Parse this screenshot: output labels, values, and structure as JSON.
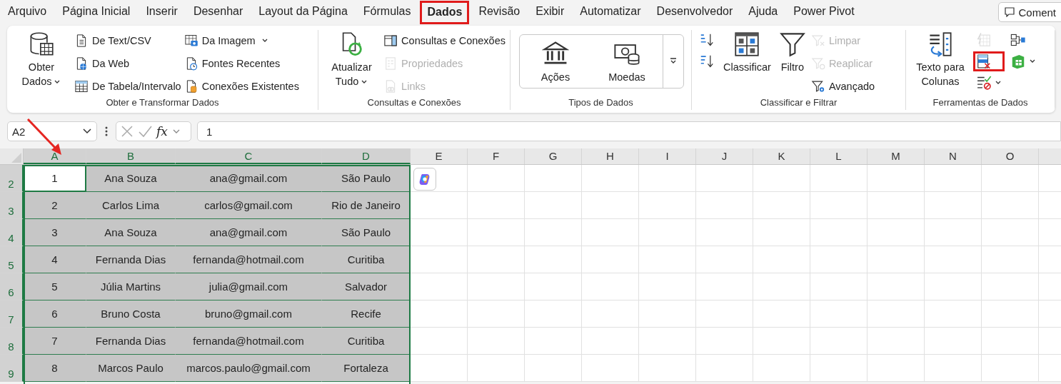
{
  "menu_tabs": [
    {
      "label": "Arquivo",
      "selected": false,
      "highlighted": false
    },
    {
      "label": "Página Inicial",
      "selected": false,
      "highlighted": false
    },
    {
      "label": "Inserir",
      "selected": false,
      "highlighted": false
    },
    {
      "label": "Desenhar",
      "selected": false,
      "highlighted": false
    },
    {
      "label": "Layout da Página",
      "selected": false,
      "highlighted": false
    },
    {
      "label": "Fórmulas",
      "selected": false,
      "highlighted": false
    },
    {
      "label": "Dados",
      "selected": true,
      "highlighted": true
    },
    {
      "label": "Revisão",
      "selected": false,
      "highlighted": false
    },
    {
      "label": "Exibir",
      "selected": false,
      "highlighted": false
    },
    {
      "label": "Automatizar",
      "selected": false,
      "highlighted": false
    },
    {
      "label": "Desenvolvedor",
      "selected": false,
      "highlighted": false
    },
    {
      "label": "Ajuda",
      "selected": false,
      "highlighted": false
    },
    {
      "label": "Power Pivot",
      "selected": false,
      "highlighted": false
    }
  ],
  "comments_button": {
    "label": "Coment"
  },
  "ribbon": {
    "groups": [
      {
        "label": "Obter e Transformar Dados",
        "buttons": [
          {
            "kind": "large",
            "label": "Obter Dados",
            "dropdown": true,
            "disabled": false,
            "highlighted": false
          },
          {
            "kind": "small",
            "label": "De Text/CSV",
            "dropdown": false,
            "disabled": false,
            "highlighted": false
          },
          {
            "kind": "small",
            "label": "Da Web",
            "dropdown": false,
            "disabled": false,
            "highlighted": false
          },
          {
            "kind": "small",
            "label": "De Tabela/Intervalo",
            "dropdown": false,
            "disabled": false,
            "highlighted": false
          },
          {
            "kind": "small",
            "label": "Da Imagem",
            "dropdown": true,
            "disabled": false,
            "highlighted": false
          },
          {
            "kind": "small",
            "label": "Fontes Recentes",
            "dropdown": false,
            "disabled": false,
            "highlighted": false
          },
          {
            "kind": "small",
            "label": "Conexões Existentes",
            "dropdown": false,
            "disabled": false,
            "highlighted": false
          }
        ]
      },
      {
        "label": "Consultas e Conexões",
        "buttons": [
          {
            "kind": "large",
            "label": "Atualizar Tudo",
            "dropdown": true,
            "disabled": false,
            "highlighted": false
          },
          {
            "kind": "small",
            "label": "Consultas e Conexões",
            "dropdown": false,
            "disabled": false,
            "highlighted": false
          },
          {
            "kind": "small",
            "label": "Propriedades",
            "dropdown": false,
            "disabled": true,
            "highlighted": false
          },
          {
            "kind": "small",
            "label": "Links",
            "dropdown": false,
            "disabled": true,
            "highlighted": false
          }
        ]
      },
      {
        "label": "Tipos de Dados",
        "buttons": [
          {
            "kind": "gallery",
            "label": "Ações"
          },
          {
            "kind": "gallery",
            "label": "Moedas"
          }
        ]
      },
      {
        "label": "Classificar e Filtrar",
        "buttons": [
          {
            "kind": "icon",
            "dropdown": false,
            "disabled": false,
            "highlighted": false
          },
          {
            "kind": "icon",
            "dropdown": false,
            "disabled": false,
            "highlighted": false
          },
          {
            "kind": "large",
            "label": "Classificar",
            "dropdown": false,
            "disabled": false,
            "highlighted": false
          },
          {
            "kind": "large",
            "label": "Filtro",
            "dropdown": false,
            "disabled": false,
            "highlighted": false
          },
          {
            "kind": "small",
            "label": "Limpar",
            "dropdown": false,
            "disabled": true,
            "highlighted": false
          },
          {
            "kind": "small",
            "label": "Reaplicar",
            "dropdown": false,
            "disabled": true,
            "highlighted": false
          },
          {
            "kind": "small",
            "label": "Avançado",
            "dropdown": false,
            "disabled": false,
            "highlighted": false
          }
        ]
      },
      {
        "label": "Ferramentas de Dados",
        "buttons": [
          {
            "kind": "large",
            "label": "Texto para Colunas",
            "dropdown": false,
            "disabled": false,
            "highlighted": false
          },
          {
            "kind": "icon",
            "dropdown": false,
            "disabled": true,
            "highlighted": false
          },
          {
            "kind": "icon",
            "dropdown": false,
            "disabled": false,
            "highlighted": true
          },
          {
            "kind": "icon",
            "dropdown": true,
            "disabled": false,
            "highlighted": false
          },
          {
            "kind": "icon",
            "dropdown": false,
            "disabled": false,
            "highlighted": false
          },
          {
            "kind": "icon",
            "dropdown": true,
            "disabled": false,
            "highlighted": false
          }
        ]
      }
    ]
  },
  "formula_bar": {
    "name_box": "A2",
    "fx_label": "fx",
    "value": "1"
  },
  "sheet": {
    "columns": [
      {
        "label": "A",
        "selected": true
      },
      {
        "label": "B",
        "selected": true
      },
      {
        "label": "C",
        "selected": true
      },
      {
        "label": "D",
        "selected": true
      },
      {
        "label": "E",
        "selected": false
      },
      {
        "label": "F",
        "selected": false
      },
      {
        "label": "G",
        "selected": false
      },
      {
        "label": "H",
        "selected": false
      },
      {
        "label": "I",
        "selected": false
      },
      {
        "label": "J",
        "selected": false
      },
      {
        "label": "K",
        "selected": false
      },
      {
        "label": "L",
        "selected": false
      },
      {
        "label": "M",
        "selected": false
      },
      {
        "label": "N",
        "selected": false
      },
      {
        "label": "O",
        "selected": false
      }
    ],
    "rows": [
      {
        "number": "2",
        "selected": true,
        "cells": [
          {
            "text": "1",
            "active": true
          },
          {
            "text": "Ana Souza",
            "active": false
          },
          {
            "text": "ana@gmail.com",
            "active": false
          },
          {
            "text": "São Paulo",
            "active": false
          }
        ]
      },
      {
        "number": "3",
        "selected": true,
        "cells": [
          {
            "text": "2",
            "active": false
          },
          {
            "text": "Carlos Lima",
            "active": false
          },
          {
            "text": "carlos@gmail.com",
            "active": false
          },
          {
            "text": "Rio de Janeiro",
            "active": false
          }
        ]
      },
      {
        "number": "4",
        "selected": true,
        "cells": [
          {
            "text": "3",
            "active": false
          },
          {
            "text": "Ana Souza",
            "active": false
          },
          {
            "text": "ana@gmail.com",
            "active": false
          },
          {
            "text": "São Paulo",
            "active": false
          }
        ]
      },
      {
        "number": "5",
        "selected": true,
        "cells": [
          {
            "text": "4",
            "active": false
          },
          {
            "text": "Fernanda Dias",
            "active": false
          },
          {
            "text": "fernanda@hotmail.com",
            "active": false
          },
          {
            "text": "Curitiba",
            "active": false
          }
        ]
      },
      {
        "number": "6",
        "selected": true,
        "cells": [
          {
            "text": "5",
            "active": false
          },
          {
            "text": "Júlia Martins",
            "active": false
          },
          {
            "text": "julia@gmail.com",
            "active": false
          },
          {
            "text": "Salvador",
            "active": false
          }
        ]
      },
      {
        "number": "7",
        "selected": true,
        "cells": [
          {
            "text": "6",
            "active": false
          },
          {
            "text": "Bruno Costa",
            "active": false
          },
          {
            "text": "bruno@gmail.com",
            "active": false
          },
          {
            "text": "Recife",
            "active": false
          }
        ]
      },
      {
        "number": "8",
        "selected": true,
        "cells": [
          {
            "text": "7",
            "active": false
          },
          {
            "text": "Fernanda Dias",
            "active": false
          },
          {
            "text": "fernanda@hotmail.com",
            "active": false
          },
          {
            "text": "Curitiba",
            "active": false
          }
        ]
      },
      {
        "number": "9",
        "selected": true,
        "cells": [
          {
            "text": "8",
            "active": false
          },
          {
            "text": "Marcos Paulo",
            "active": false
          },
          {
            "text": "marcos.paulo@gmail.com",
            "active": false
          },
          {
            "text": "Fortaleza",
            "active": false
          }
        ]
      }
    ]
  }
}
